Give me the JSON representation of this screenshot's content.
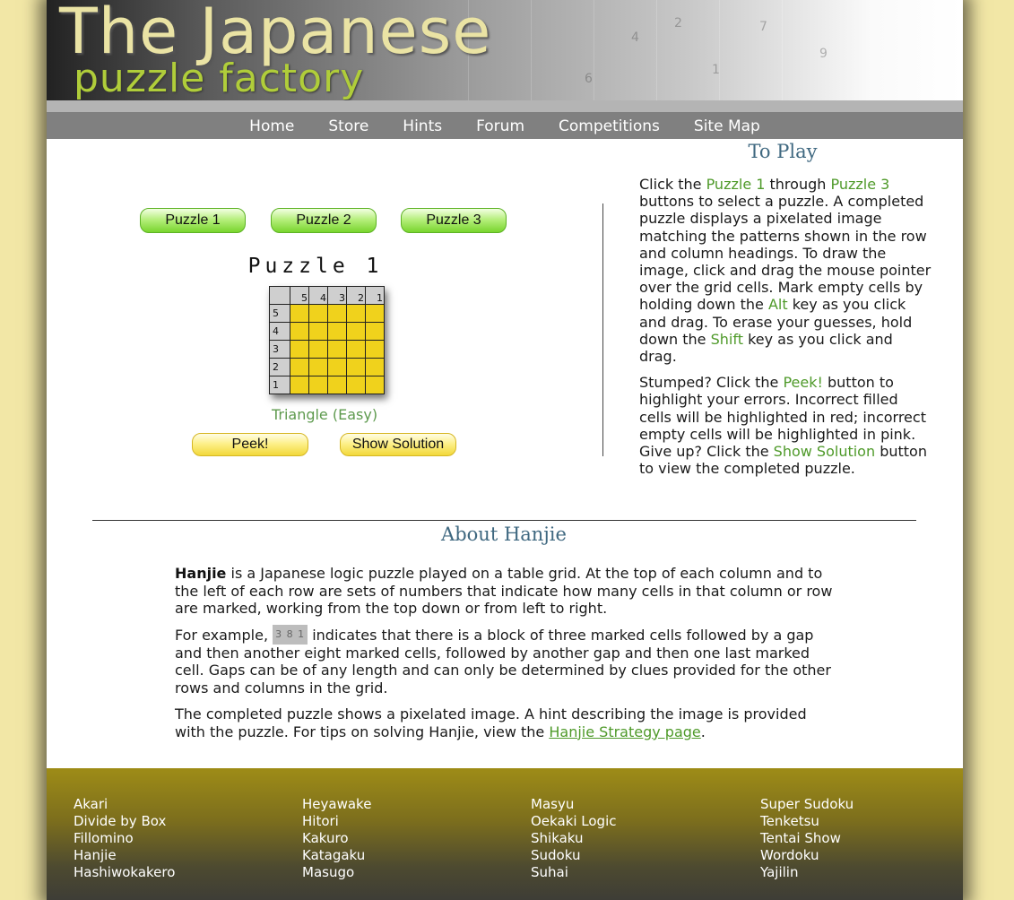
{
  "header": {
    "title_line1": "The Japanese",
    "title_line2": "puzzle factory"
  },
  "nav": [
    "Home",
    "Store",
    "Hints",
    "Forum",
    "Competitions",
    "Site Map"
  ],
  "puzzle": {
    "buttons": [
      "Puzzle 1",
      "Puzzle 2",
      "Puzzle 3"
    ],
    "title": "Puzzle 1",
    "column_clues": [
      "5",
      "4",
      "3",
      "2",
      "1"
    ],
    "row_clues": [
      "5",
      "4",
      "3",
      "2",
      "1"
    ],
    "hint": "Triangle (Easy)",
    "peek_label": "Peek!",
    "solution_label": "Show Solution"
  },
  "to_play": {
    "heading": "To Play",
    "p1_a": "Click the ",
    "p1_link1": "Puzzle 1",
    "p1_b": " through ",
    "p1_link2": "Puzzle 3",
    "p1_c": " buttons to select a puzzle. A completed puzzle displays a pixelated image matching the patterns shown in the row and column headings. To draw the image, click and drag the mouse pointer over the grid cells. Mark empty cells by holding down the ",
    "p1_key1": "Alt",
    "p1_d": " key as you click and drag. To erase your guesses, hold down the ",
    "p1_key2": "Shift",
    "p1_e": " key as you click and drag.",
    "p2_a": "Stumped? Click the ",
    "p2_link1": "Peek!",
    "p2_b": " button to highlight your errors. Incorrect filled cells will be highlighted in red; incorrect empty cells will be highlighted in pink. Give up? Click the ",
    "p2_link2": "Show Solution",
    "p2_c": " button to view the completed puzzle."
  },
  "about": {
    "heading": "About Hanjie",
    "p1_bold": "Hanjie",
    "p1_rest": " is a Japanese logic puzzle played on a table grid. At the top of each column and to the left of each row are sets of numbers that indicate how many cells in that column or row are marked, working from the top down or from left to right.",
    "p2_a": "For example, ",
    "p2_example": "3 8 1",
    "p2_b": " indicates that there is a block of three marked cells followed by a gap and then another eight marked cells, followed by another gap and then one last marked cell. Gaps can be of any length and can only be determined by clues provided for the other rows and columns in the grid.",
    "p3_a": "The completed puzzle shows a pixelated image. A hint describing the image is provided with the puzzle. For tips on solving Hanjie, view the ",
    "p3_link": "Hanjie Strategy page",
    "p3_b": "."
  },
  "footer": {
    "col1": [
      "Akari",
      "Divide by Box",
      "Fillomino",
      "Hanjie",
      "Hashiwokakero"
    ],
    "col2": [
      "Heyawake",
      "Hitori",
      "Kakuro",
      "Katagaku",
      "Masugo"
    ],
    "col3": [
      "Masyu",
      "Oekaki Logic",
      "Shikaku",
      "Sudoku",
      "Suhai"
    ],
    "col4": [
      "Super Sudoku",
      "Tenketsu",
      "Tentai Show",
      "Wordoku",
      "Yajilin"
    ]
  },
  "colors": {
    "accent_green": "#4f9a2a",
    "heading_blue": "#3f6880",
    "cell_yellow": "#f0d21c",
    "nav_gray": "#808080"
  }
}
